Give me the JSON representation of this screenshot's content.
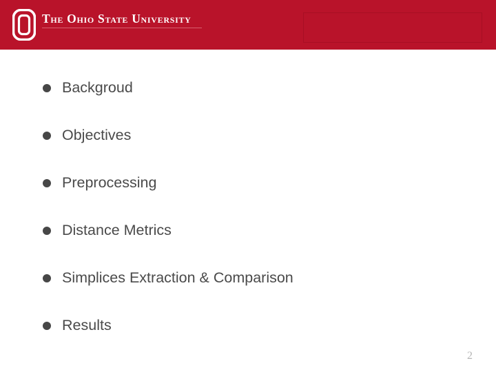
{
  "slide": {
    "page_number": "2",
    "background_color": "#ffffff"
  },
  "banner": {
    "background_color": "#b9132a",
    "logo": {
      "icon": "ohio-state-block-o-logo",
      "color": "#ffffff"
    },
    "wordmark": "The Ohio State University",
    "placeholder_box": {
      "label": "",
      "border_color": "#a80f24"
    }
  },
  "content": {
    "bullet_color": "#474747",
    "text_color": "#4a4a4a",
    "items": [
      {
        "label": "Backgroud"
      },
      {
        "label": "Objectives"
      },
      {
        "label": "Preprocessing"
      },
      {
        "label": "Distance Metrics"
      },
      {
        "label": "Simplices Extraction & Comparison"
      },
      {
        "label": "Results"
      }
    ]
  }
}
